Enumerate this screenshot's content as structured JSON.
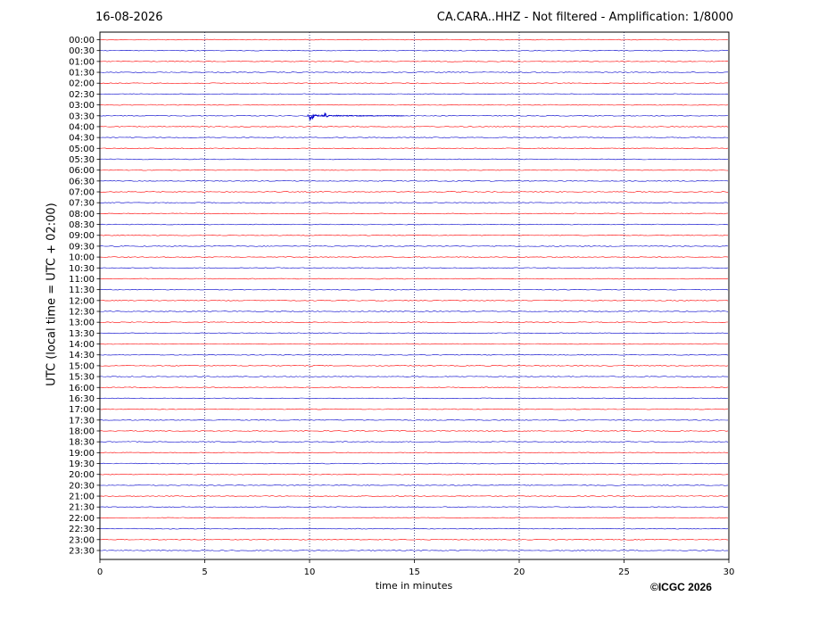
{
  "header": {
    "date": "16-08-2026",
    "title": "CA.CARA..HHZ - Not filtered - Amplification: 1/8000"
  },
  "footer": {
    "copyright": "©ICGC 2026"
  },
  "chart_data": {
    "type": "line",
    "title": "CA.CARA..HHZ - Not filtered - Amplification: 1/8000",
    "xlabel": "time in minutes",
    "ylabel": "UTC (local time = UTC + 02:00)",
    "xlim": [
      0,
      30
    ],
    "x_ticks": [
      0,
      5,
      10,
      15,
      20,
      25,
      30
    ],
    "x_gridlines": [
      5,
      10,
      15,
      20,
      25
    ],
    "grid": "vertical dotted",
    "line_colors": [
      "#ff0000",
      "#0000cc"
    ],
    "trace_labels": [
      "00:00",
      "00:30",
      "01:00",
      "01:30",
      "02:00",
      "02:30",
      "03:00",
      "03:30",
      "04:00",
      "04:30",
      "05:00",
      "05:30",
      "06:00",
      "06:30",
      "07:00",
      "07:30",
      "08:00",
      "08:30",
      "09:00",
      "09:30",
      "10:00",
      "10:30",
      "11:00",
      "11:30",
      "12:00",
      "12:30",
      "13:00",
      "13:30",
      "14:00",
      "14:30",
      "15:00",
      "15:30",
      "16:00",
      "16:30",
      "17:00",
      "17:30",
      "18:00",
      "18:30",
      "19:00",
      "19:30",
      "20:00",
      "20:30",
      "21:00",
      "21:30",
      "22:00",
      "22:30",
      "23:00",
      "23:30"
    ],
    "events": [
      {
        "trace": "03:30",
        "start_minute": 9.9,
        "end_minute": 14.5,
        "peak_minute": 10.0,
        "secondary_peak_minute": 10.7
      }
    ]
  }
}
